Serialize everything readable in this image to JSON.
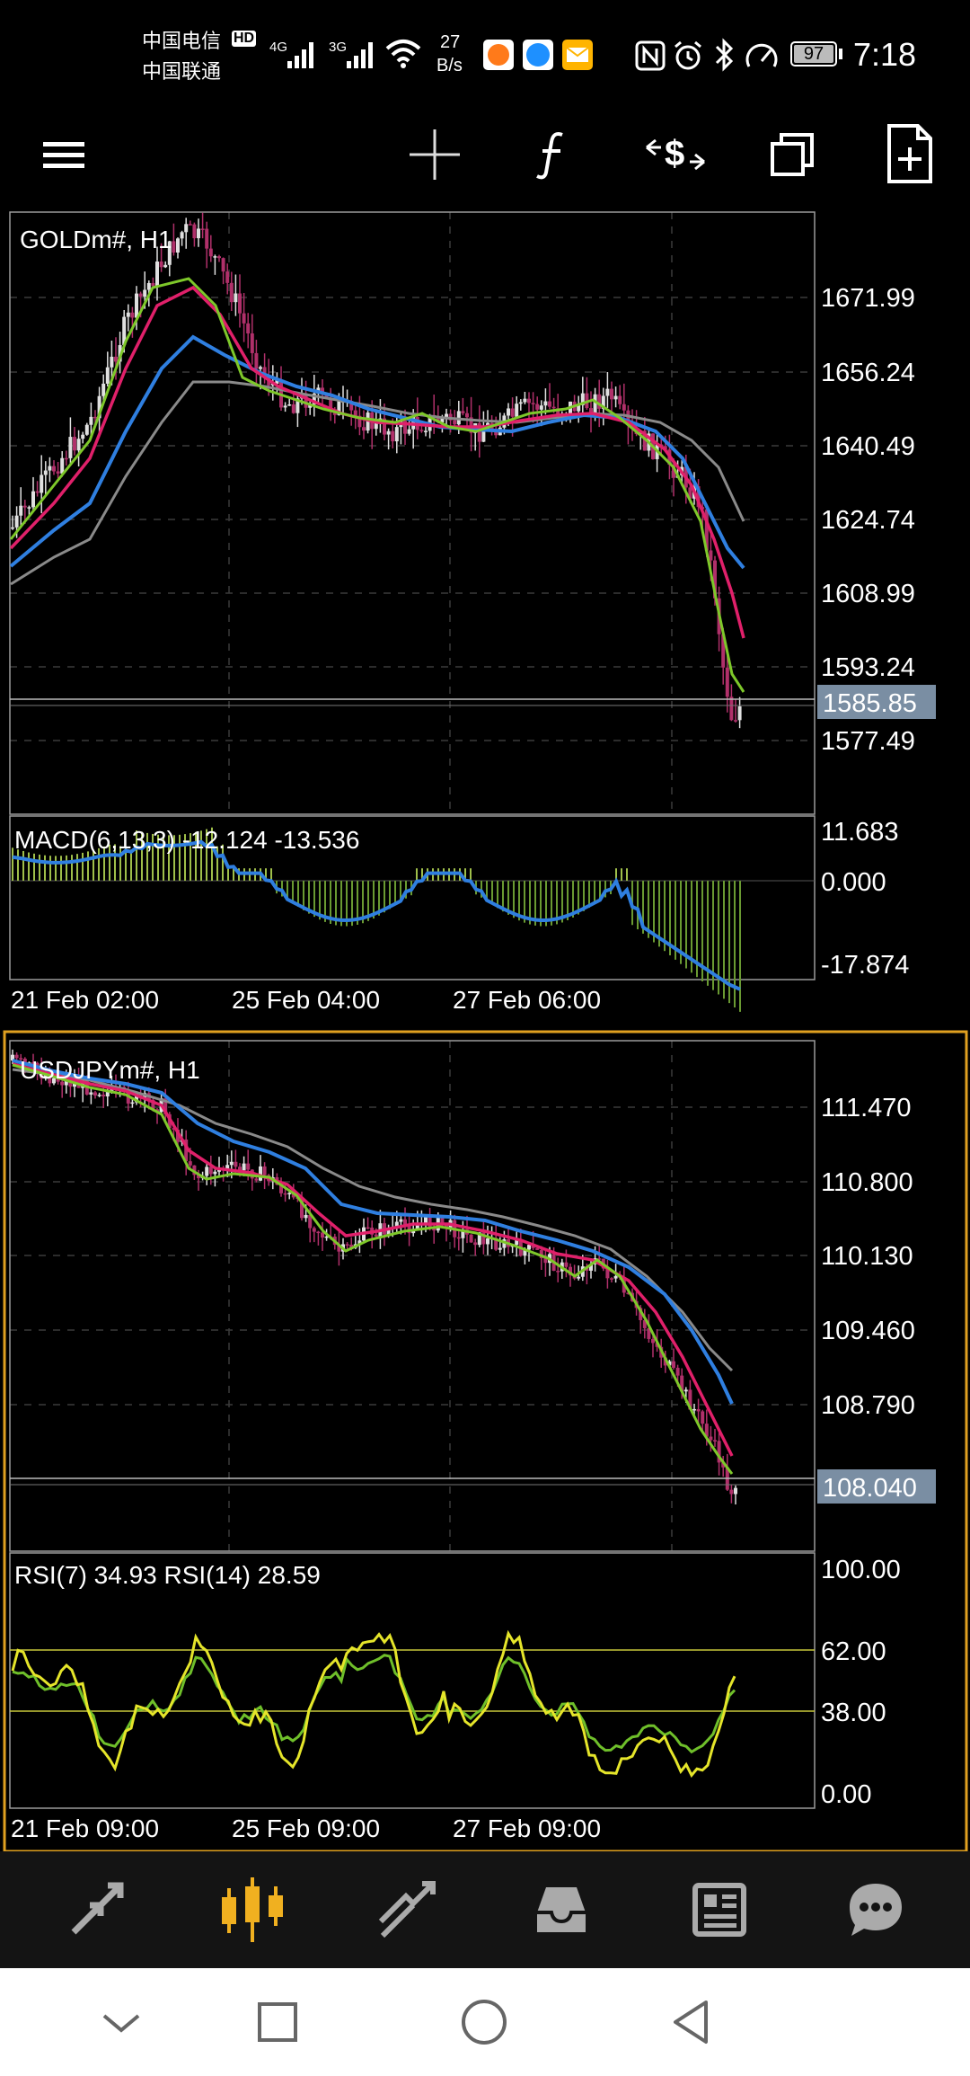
{
  "status": {
    "carrier1": "中国电信",
    "carrier2": "中国联通",
    "hd": "HD",
    "net1": "4G",
    "net2": "3G",
    "speed_value": "27",
    "speed_unit": "B/s",
    "battery": "97",
    "time": "7:18"
  },
  "colors": {
    "accent": "#e0a020",
    "ema_green": "#7ec82a",
    "ema_red": "#e0206a",
    "ema_blue": "#2f7fe0",
    "ema_gray": "#8a8a8a",
    "bull": "#e0e0e0",
    "bear": "#b0306a",
    "rsi_yellow": "#e5e52a",
    "rsi_green": "#6fbf2a",
    "price_tag": "#7a8ea3"
  },
  "chart1": {
    "title": "GOLDm#, H1",
    "price_labels": [
      "1671.99",
      "1656.24",
      "1640.49",
      "1624.74",
      "1608.99",
      "1593.24",
      "1577.49"
    ],
    "current_price": "1585.85",
    "indicator": "MACD(6,13,3) -12.124 -13.536",
    "indicator_labels": [
      "11.683",
      "0.000",
      "-17.874"
    ],
    "time_labels": [
      "21 Feb 02:00",
      "25 Feb 04:00",
      "27 Feb 06:00"
    ]
  },
  "chart2": {
    "title": "USDJPYm#, H1",
    "price_labels": [
      "111.470",
      "110.800",
      "110.130",
      "109.460",
      "108.790"
    ],
    "current_price": "108.040",
    "indicator": "RSI(7) 34.93 RSI(14) 28.59",
    "indicator_labels": [
      "100.00",
      "62.00",
      "38.00",
      "0.00"
    ],
    "time_labels": [
      "21 Feb 09:00",
      "25 Feb 09:00",
      "27 Feb 09:00"
    ]
  }
}
